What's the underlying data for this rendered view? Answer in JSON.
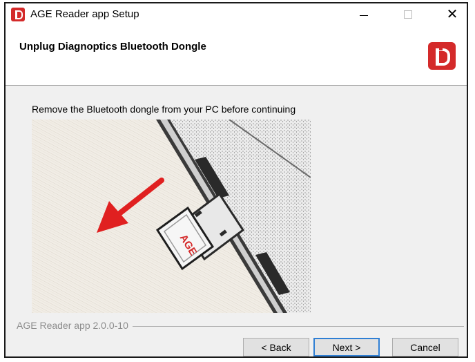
{
  "window": {
    "title": "AGE Reader app Setup",
    "controls": {
      "minimize": "—",
      "maximize": "☐",
      "close": "✕"
    }
  },
  "header": {
    "title": "Unplug Diagnoptics Bluetooth Dongle"
  },
  "main": {
    "instruction": "Remove the Bluetooth dongle from your PC before continuing",
    "dongle_brand": "AGE"
  },
  "footer": {
    "version": "AGE Reader app 2.0.0-10",
    "back_label": "< Back",
    "next_label": "Next >",
    "cancel_label": "Cancel"
  },
  "colors": {
    "brand_red": "#d42a2a",
    "focus_blue": "#2f7fd4"
  }
}
